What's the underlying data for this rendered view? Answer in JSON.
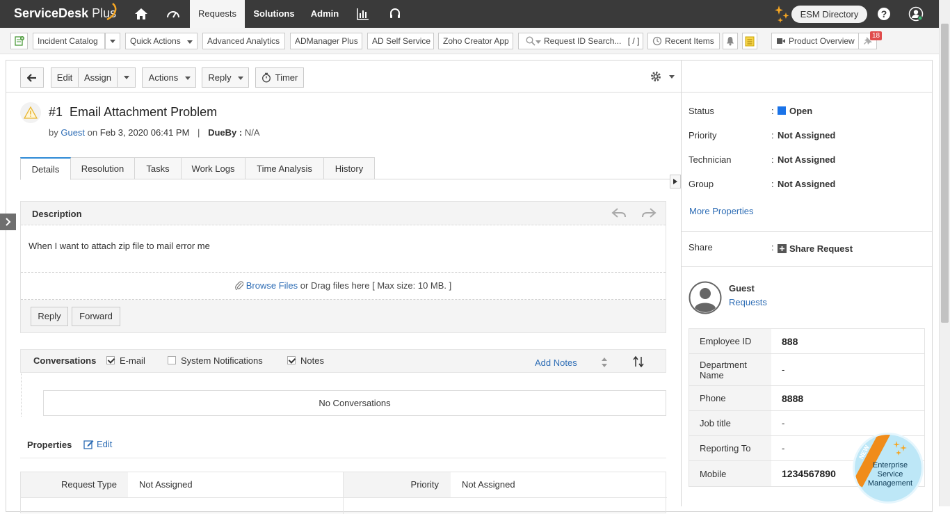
{
  "app": {
    "logo_text": "ServiceDesk",
    "logo_plus": "Plus"
  },
  "topnav": {
    "items": [
      {
        "label": "Requests",
        "active": true
      },
      {
        "label": "Solutions"
      },
      {
        "label": "Admin"
      }
    ],
    "esm_directory": "ESM Directory"
  },
  "toolbar": {
    "incident_catalog": "Incident Catalog",
    "quick_actions": "Quick Actions",
    "advanced_analytics": "Advanced Analytics",
    "admanager": "ADManager Plus",
    "ad_self_service": "AD Self Service",
    "zoho_creator": "Zoho Creator App",
    "search_placeholder": "Request ID Search...",
    "search_shortcut": "[ / ]",
    "recent_items": "Recent Items",
    "product_overview": "Product Overview",
    "badge_count": "18"
  },
  "actions": {
    "edit": "Edit",
    "assign": "Assign",
    "actions": "Actions",
    "reply": "Reply",
    "timer": "Timer"
  },
  "request": {
    "id": "#1",
    "title": "Email Attachment Problem",
    "by_label": "by",
    "requester": "Guest",
    "on_label": "on",
    "date": "Feb 3, 2020 06:41 PM",
    "separator": "|",
    "dueby_label": "DueBy :",
    "dueby_value": "N/A"
  },
  "tabs": [
    "Details",
    "Resolution",
    "Tasks",
    "Work Logs",
    "Time Analysis",
    "History"
  ],
  "description": {
    "heading": "Description",
    "body": "When I want to attach zip file to mail error me",
    "browse_files": "Browse Files",
    "drag_text": "or Drag files here [ Max size: 10 MB. ]",
    "reply": "Reply",
    "forward": "Forward"
  },
  "conversations": {
    "heading": "Conversations",
    "email": "E-mail",
    "system_notifications": "System Notifications",
    "notes": "Notes",
    "add_notes": "Add Notes",
    "empty": "No Conversations"
  },
  "properties": {
    "heading": "Properties",
    "edit": "Edit",
    "request_type_label": "Request Type",
    "request_type_value": "Not Assigned",
    "priority_label": "Priority",
    "priority_value": "Not Assigned"
  },
  "sidebar": {
    "status_label": "Status",
    "status_value": "Open",
    "status_color": "#1a73e8",
    "priority_label": "Priority",
    "priority_value": "Not Assigned",
    "technician_label": "Technician",
    "technician_value": "Not Assigned",
    "group_label": "Group",
    "group_value": "Not Assigned",
    "colon": ":",
    "more_properties": "More Properties",
    "share_label": "Share",
    "share_request": "Share Request",
    "requester_name": "Guest",
    "requests_link": "Requests",
    "employee": [
      {
        "key": "Employee ID",
        "value": "888"
      },
      {
        "key": "Department Name",
        "value": "-"
      },
      {
        "key": "Phone",
        "value": "8888"
      },
      {
        "key": "Job title",
        "value": "-"
      },
      {
        "key": "Reporting To",
        "value": "-"
      },
      {
        "key": "Mobile",
        "value": "1234567890"
      }
    ]
  },
  "esm_badge": {
    "new": "NEW",
    "line1": "Enterprise",
    "line2": "Service",
    "line3": "Management"
  }
}
